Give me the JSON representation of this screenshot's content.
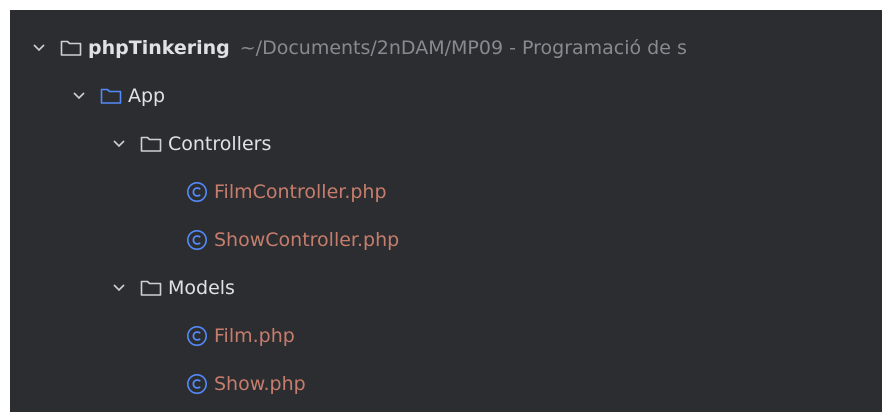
{
  "tree": {
    "root": {
      "label": "phpTinkering",
      "path": "~/Documents/2nDAM/MP09 - Programació de s",
      "icon": "folder-icon"
    },
    "nodes": [
      {
        "label": "App",
        "kind": "folder",
        "expanded": true,
        "icon": "module-folder-icon"
      },
      {
        "label": "Controllers",
        "kind": "folder",
        "expanded": true,
        "icon": "folder-icon"
      },
      {
        "label": "FilmController.php",
        "kind": "file",
        "icon": "php-class-icon"
      },
      {
        "label": "ShowController.php",
        "kind": "file",
        "icon": "php-class-icon"
      },
      {
        "label": "Models",
        "kind": "folder",
        "expanded": true,
        "icon": "folder-icon"
      },
      {
        "label": "Film.php",
        "kind": "file",
        "icon": "php-class-icon"
      },
      {
        "label": "Show.php",
        "kind": "file",
        "icon": "php-class-icon"
      }
    ]
  },
  "colors": {
    "background": "#2b2d30",
    "text": "#dfe1e5",
    "path_text": "#868a91",
    "file_text": "#c77d6d",
    "class_icon": "#548af7",
    "module_folder": "#548af7",
    "folder_outline": "#ced0d6"
  }
}
